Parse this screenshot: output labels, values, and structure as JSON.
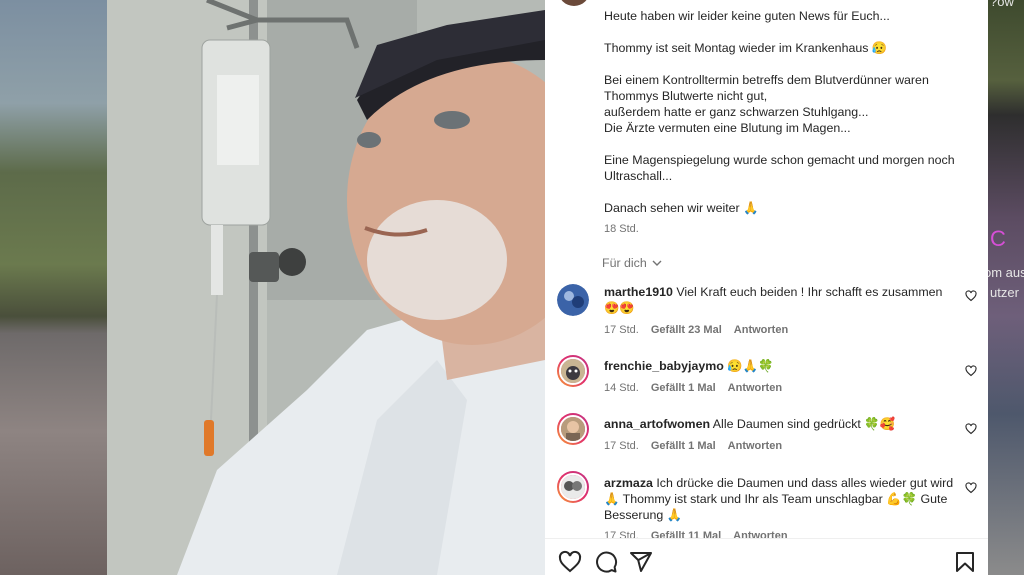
{
  "background": {
    "right_text": [
      "?ow",
      "C",
      "om aus",
      "utzer"
    ]
  },
  "post": {
    "caption": [
      "Heute haben wir leider keine guten News für Euch...",
      "Thommy ist seit Montag wieder im Krankenhaus 😥",
      "Bei einem Kontrolltermin betreffs dem Blutverdünner waren",
      "Thommys Blutwerte nicht gut,",
      "außerdem hatte er ganz schwarzen Stuhlgang...",
      "Die Ärzte vermuten eine Blutung im Magen...",
      "Eine Magenspiegelung wurde schon gemacht und morgen noch",
      "Ultraschall...",
      "Danach sehen wir weiter 🙏"
    ],
    "time": "18 Std.",
    "translate_label": "Für dich"
  },
  "comments": [
    {
      "username": "marthe1910",
      "text_line1": "Viel Kraft euch beiden ! Ihr schafft es zusammen",
      "text_line2": "😍😍",
      "time": "17 Std.",
      "likes": "Gefällt 23 Mal",
      "reply": "Antworten"
    },
    {
      "username": "frenchie_babyjaymo",
      "text_line1": "😥🙏🍀",
      "time": "14 Std.",
      "likes": "Gefällt 1 Mal",
      "reply": "Antworten"
    },
    {
      "username": "anna_artofwomen",
      "text_line1": "Alle Daumen sind gedrückt 🍀🥰",
      "time": "17 Std.",
      "likes": "Gefällt 1 Mal",
      "reply": "Antworten"
    },
    {
      "username": "arzmaza",
      "text_line1": "Ich drücke die Daumen und dass alles wieder gut wird",
      "text_line2": "🙏 Thommy ist stark und Ihr als Team unschlagbar 💪🍀 Gute",
      "text_line3": "Besserung 🙏",
      "time": "17 Std.",
      "likes": "Gefällt 11 Mal",
      "reply": "Antworten"
    }
  ],
  "actions": {
    "like_icon": "heart-icon",
    "comment_icon": "comment-icon",
    "share_icon": "share-icon",
    "save_icon": "bookmark-icon"
  }
}
